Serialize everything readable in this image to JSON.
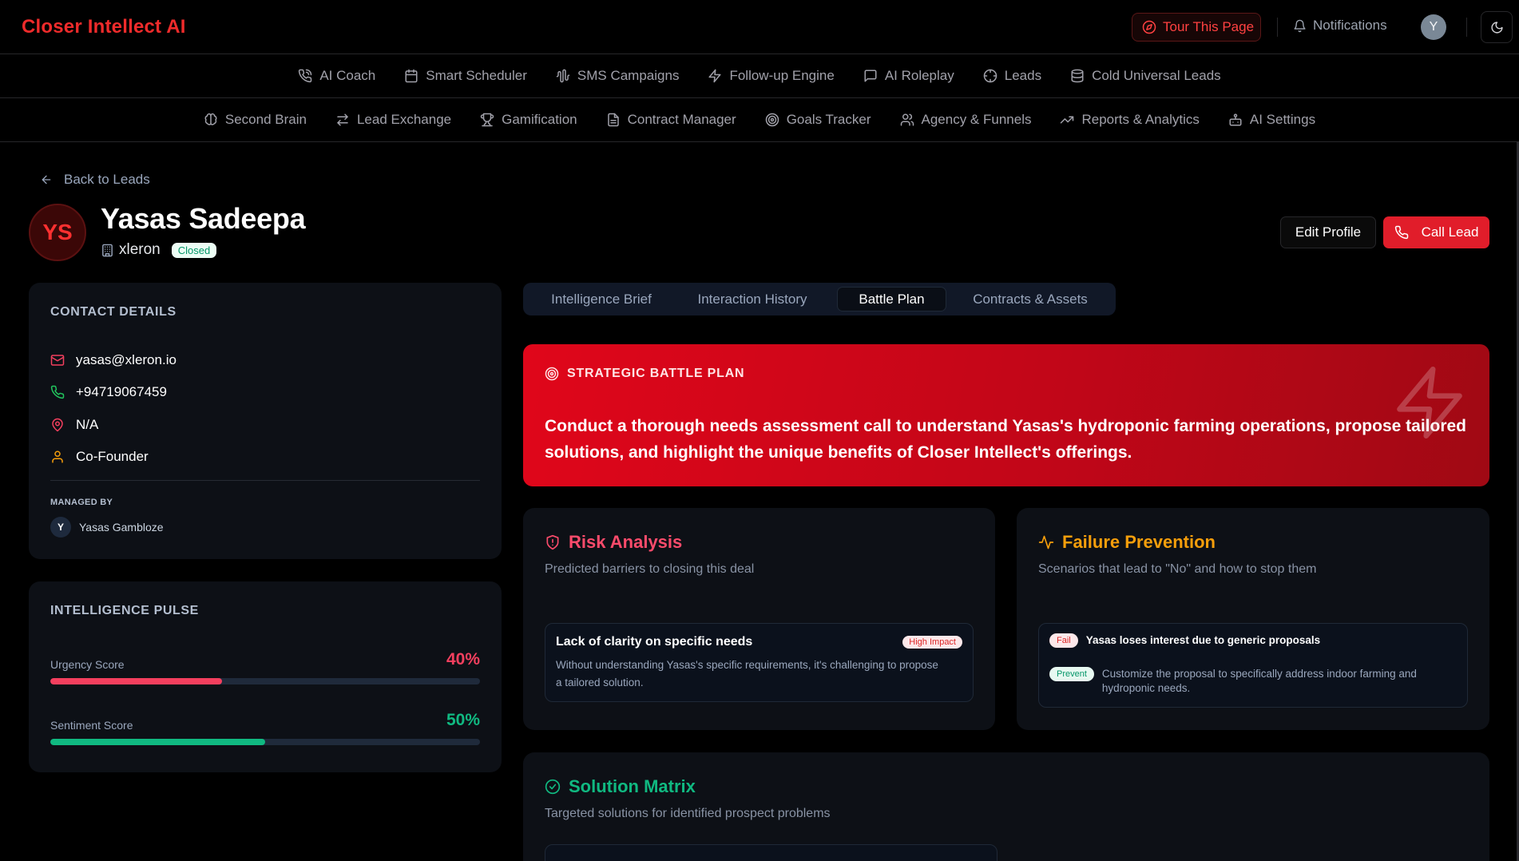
{
  "app": {
    "brand": "Closer Intellect AI"
  },
  "topbar": {
    "tour_label": "Tour This Page",
    "notifications_label": "Notifications",
    "user_initial": "Y"
  },
  "nav": {
    "row1": [
      {
        "label": "AI Coach",
        "icon": "phone-call-icon"
      },
      {
        "label": "Smart Scheduler",
        "icon": "calendar-icon"
      },
      {
        "label": "SMS Campaigns",
        "icon": "audio-waveform-icon"
      },
      {
        "label": "Follow-up Engine",
        "icon": "zap-icon"
      },
      {
        "label": "AI Roleplay",
        "icon": "message-square-icon"
      },
      {
        "label": "Leads",
        "icon": "target-icon"
      },
      {
        "label": "Cold Universal Leads",
        "icon": "database-icon"
      }
    ],
    "row2": [
      {
        "label": "Second Brain",
        "icon": "brain-icon"
      },
      {
        "label": "Lead Exchange",
        "icon": "arrows-exchange-icon"
      },
      {
        "label": "Gamification",
        "icon": "trophy-icon"
      },
      {
        "label": "Contract Manager",
        "icon": "file-text-icon"
      },
      {
        "label": "Goals Tracker",
        "icon": "target-icon"
      },
      {
        "label": "Agency & Funnels",
        "icon": "users-icon"
      },
      {
        "label": "Reports & Analytics",
        "icon": "trending-up-icon"
      },
      {
        "label": "AI Settings",
        "icon": "bot-icon"
      }
    ]
  },
  "lead": {
    "back_label": "Back to Leads",
    "initials": "YS",
    "name": "Yasas Sadeepa",
    "company": "xleron",
    "status": "Closed",
    "edit_label": "Edit Profile",
    "call_label": "Call Lead"
  },
  "contact": {
    "title": "CONTACT DETAILS",
    "email": "yasas@xleron.io",
    "phone": "+94719067459",
    "location": "N/A",
    "role": "Co-Founder",
    "managed_by_label": "MANAGED BY",
    "manager_initial": "Y",
    "manager_name": "Yasas Gambloze"
  },
  "pulse": {
    "title": "INTELLIGENCE PULSE",
    "urgency_label": "Urgency Score",
    "urgency_value": "40%",
    "urgency_fraction": 0.4,
    "sentiment_label": "Sentiment Score",
    "sentiment_value": "50%",
    "sentiment_fraction": 0.5
  },
  "tabs": [
    {
      "label": "Intelligence Brief",
      "active": false
    },
    {
      "label": "Interaction History",
      "active": false
    },
    {
      "label": "Battle Plan",
      "active": true
    },
    {
      "label": "Contracts & Assets",
      "active": false
    }
  ],
  "battle_plan": {
    "label": "STRATEGIC BATTLE PLAN",
    "text": "Conduct a thorough needs assessment call to understand Yasas's hydroponic farming operations, propose tailored solutions, and highlight the unique benefits of Closer Intellect's offerings."
  },
  "risk": {
    "title": "Risk Analysis",
    "subtitle": "Predicted barriers to closing this deal",
    "item_title": "Lack of clarity on specific needs",
    "item_badge": "High Impact",
    "item_desc": "Without understanding Yasas's specific requirements, it's challenging to propose a tailored solution."
  },
  "failure": {
    "title": "Failure Prevention",
    "subtitle": "Scenarios that lead to \"No\" and how to stop them",
    "fail_badge": "Fail",
    "fail_text": "Yasas loses interest due to generic proposals",
    "prevent_badge": "Prevent",
    "prevent_text": "Customize the proposal to specifically address indoor farming and hydroponic needs."
  },
  "solution": {
    "title": "Solution Matrix",
    "subtitle": "Targeted solutions for identified prospect problems"
  },
  "colors": {
    "brand_red": "#ef2b2b",
    "urgency": "#f43f5e",
    "sentiment": "#10b981",
    "risk": "#fb4b6b",
    "failure": "#f59e0b",
    "solution": "#10b981"
  }
}
